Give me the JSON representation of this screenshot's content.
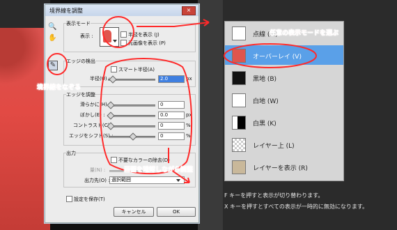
{
  "dialog": {
    "title": "境界線を調整",
    "close": "×",
    "view_mode": {
      "legend": "表示モード",
      "view_label": "表示 :",
      "show_radius": "半径を表示 (J)",
      "show_original": "元画像を表示 (P)"
    },
    "edge_detection": {
      "legend": "エッジの検出",
      "smart_radius": "スマート半径(A)",
      "radius_label": "半径(U) :",
      "radius_value": "2.0",
      "radius_unit": "px"
    },
    "adjust_edge": {
      "legend": "エッジを調整",
      "rows": [
        {
          "label": "滑らかに(H) :",
          "value": "0",
          "unit": ""
        },
        {
          "label": "ぼかし(E) :",
          "value": "0.0",
          "unit": "px"
        },
        {
          "label": "コントラスト(C) :",
          "value": "0",
          "unit": "%"
        },
        {
          "label": "エッジをシフト(S) :",
          "value": "0",
          "unit": "%"
        }
      ]
    },
    "output": {
      "legend": "出力",
      "decontaminate": "不要なカラーの除去(D)",
      "amount_label": "量(N) :",
      "output_to_label": "出力先(O) :",
      "output_to_value": "選択範囲"
    },
    "remember": "設定を保存(T)",
    "cancel": "キャンセル",
    "ok": "OK"
  },
  "view_menu": {
    "items": [
      {
        "label": "点線 (M)",
        "selected": false
      },
      {
        "label": "オーバーレイ (V)",
        "selected": true
      },
      {
        "label": "黒地 (B)",
        "selected": false
      },
      {
        "label": "白地 (W)",
        "selected": false
      },
      {
        "label": "白黒 (K)",
        "selected": false
      },
      {
        "label": "レイヤー上 (L)",
        "selected": false
      },
      {
        "label": "レイヤーを表示 (R)",
        "selected": false
      }
    ],
    "notes": [
      "F キーを押すと表示が切り替わります。",
      "X キーを押すとすべての表示が一時的に無効になります。"
    ]
  },
  "annotations": {
    "choose_mode": "任意の表示モードを選ぶ",
    "trace_edge": "境界線をなぞる",
    "adjust_while_checking": "画面を確認しながら調整"
  },
  "colors": {
    "annotation": "#ff2a2a",
    "selected_item": "#5aa0e8",
    "overlay_red": "#e24a44"
  }
}
